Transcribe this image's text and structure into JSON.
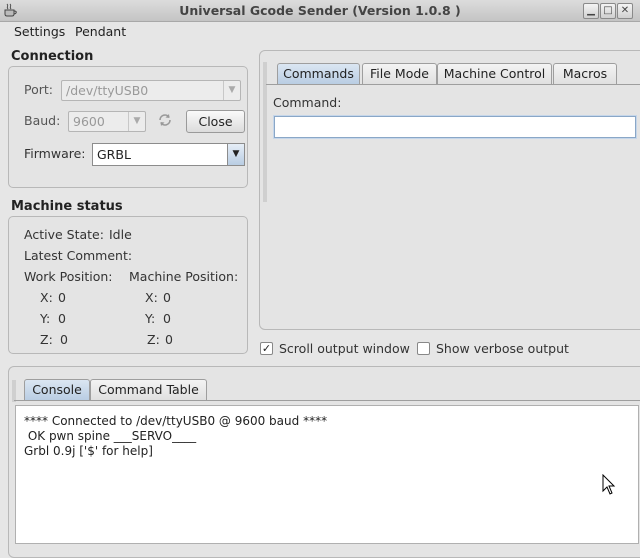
{
  "window": {
    "title": "Universal Gcode Sender (Version 1.0.8 )",
    "app_icon": "java-app-icon",
    "controls": [
      "minimize-icon",
      "maximize-icon",
      "close-icon"
    ]
  },
  "menu": {
    "settings": "Settings",
    "pendant": "Pendant"
  },
  "connection": {
    "title": "Connection",
    "port_label": "Port:",
    "port_value": "/dev/ttyUSB0",
    "baud_label": "Baud:",
    "baud_value": "9600",
    "refresh_icon": "refresh-icon",
    "close_button": "Close",
    "firmware_label": "Firmware:",
    "firmware_value": "GRBL"
  },
  "machine_status": {
    "title": "Machine status",
    "active_state_label": "Active State:",
    "active_state_value": "Idle",
    "latest_comment_label": "Latest Comment:",
    "work_position_label": "Work Position:",
    "machine_position_label": "Machine Position:",
    "work": {
      "x_label": "X:",
      "x": "0",
      "y_label": "Y:",
      "y": "0",
      "z_label": "Z:",
      "z": "0"
    },
    "machine": {
      "x_label": "X:",
      "x": "0",
      "y_label": "Y:",
      "y": "0",
      "z_label": "Z:",
      "z": "0"
    }
  },
  "command_tabs": [
    "Commands",
    "File Mode",
    "Machine Control",
    "Macros"
  ],
  "command": {
    "label": "Command:",
    "value": ""
  },
  "options": {
    "scroll_output": {
      "label": "Scroll output window",
      "checked": true
    },
    "verbose_output": {
      "label": "Show verbose output",
      "checked": false
    }
  },
  "console_tabs": [
    "Console",
    "Command Table"
  ],
  "console_lines": [
    "**** Connected to /dev/ttyUSB0 @ 9600 baud ****",
    " OK pwn spine ___SERVO____",
    "Grbl 0.9j ['$' for help]"
  ]
}
